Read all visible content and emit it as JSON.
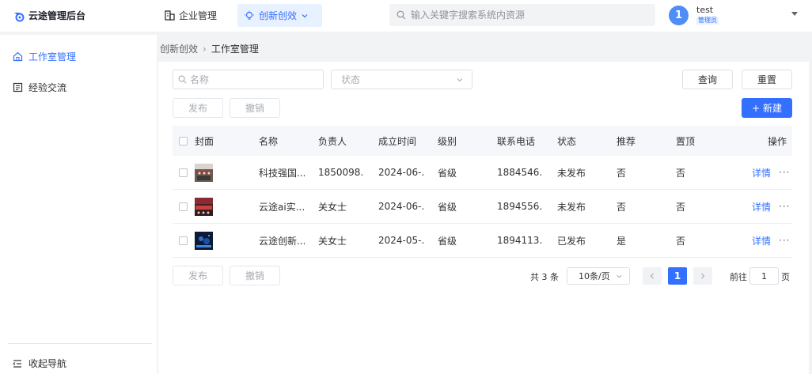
{
  "header": {
    "app_title": "云途管理后台",
    "nav": [
      {
        "label": "企业管理",
        "icon": "building-icon"
      },
      {
        "label": "创新创效",
        "icon": "lightbulb-icon"
      }
    ],
    "search_placeholder": "输入关键字搜索系统内资源",
    "user": {
      "avatar_text": "1",
      "name": "test",
      "role": "管理员"
    }
  },
  "sidebar": {
    "items": [
      {
        "label": "工作室管理",
        "icon": "home-icon",
        "active": true
      },
      {
        "label": "经验交流",
        "icon": "document-icon",
        "active": false
      }
    ],
    "collapse_label": "收起导航"
  },
  "breadcrumb": {
    "parent": "创新创效",
    "current": "工作室管理"
  },
  "filters": {
    "name_placeholder": "名称",
    "status_placeholder": "状态",
    "query_label": "查询",
    "reset_label": "重置"
  },
  "actions": {
    "publish_label": "发布",
    "revoke_label": "撤销",
    "new_label": "新建"
  },
  "table": {
    "columns": [
      "封面",
      "名称",
      "负责人",
      "成立时间",
      "级别",
      "联系电话",
      "状态",
      "推荐",
      "置顶",
      "操作"
    ],
    "rows": [
      {
        "name": "科技强国...",
        "owner": "1850098...",
        "date": "2024-06-...",
        "level": "省级",
        "phone": "1884546...",
        "status": "未发布",
        "recommend": "否",
        "top": "否",
        "detail": "详情",
        "more": "···"
      },
      {
        "name": "云途ai实...",
        "owner": "关女士",
        "date": "2024-06-...",
        "level": "省级",
        "phone": "1894556...",
        "status": "未发布",
        "recommend": "否",
        "top": "否",
        "detail": "详情",
        "more": "···"
      },
      {
        "name": "云途创新...",
        "owner": "关女士",
        "date": "2024-05-...",
        "level": "省级",
        "phone": "1894113...",
        "status": "已发布",
        "recommend": "是",
        "top": "否",
        "detail": "详情",
        "more": "···"
      }
    ]
  },
  "pagination": {
    "total_text": "共 3 条",
    "page_size": "10条/页",
    "current_page": "1",
    "goto_label": "前往",
    "goto_value": "1",
    "goto_suffix": "页"
  },
  "colors": {
    "accent": "#3470ff",
    "avatar": "#4f8df7"
  }
}
